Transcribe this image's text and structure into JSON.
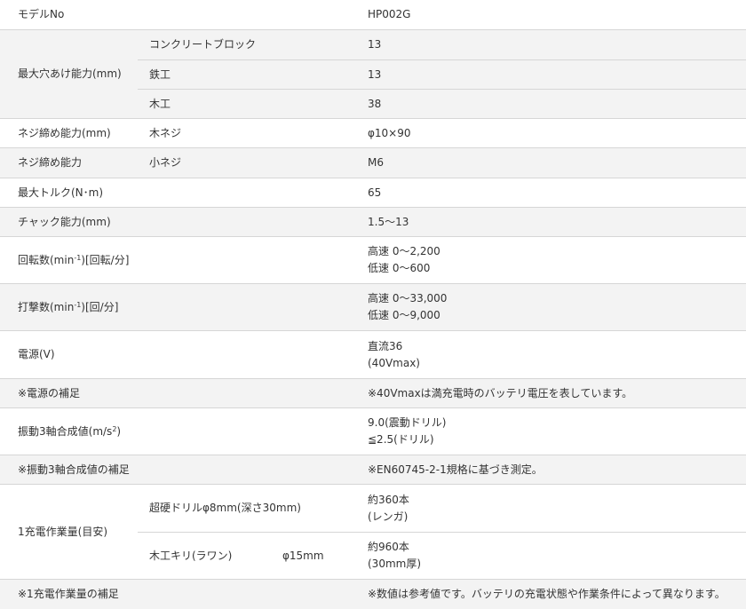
{
  "rows": {
    "model": {
      "label": "モデルNo",
      "value": "HP002G"
    },
    "drill": {
      "label": "最大穴あけ能力(mm)",
      "items": [
        {
          "sub": "コンクリートブロック",
          "value": "13"
        },
        {
          "sub": "鉄工",
          "value": "13"
        },
        {
          "sub": "木工",
          "value": "38"
        }
      ]
    },
    "screw_wood": {
      "label": "ネジ締め能力(mm)",
      "sub": "木ネジ",
      "value": "φ10×90"
    },
    "screw_small": {
      "label": "ネジ締め能力",
      "sub": "小ネジ",
      "value": "M6"
    },
    "torque": {
      "label": "最大トルク(N･m)",
      "value": "65"
    },
    "chuck": {
      "label": "チャック能力(mm)",
      "value": "1.5〜13"
    },
    "rpm": {
      "label_pre": "回転数(min",
      "label_sup": "-1",
      "label_post": ")[回転/分]",
      "line1": "高速 0〜2,200",
      "line2": "低速 0〜600"
    },
    "ipm": {
      "label_pre": "打撃数(min",
      "label_sup": "-1",
      "label_post": ")[回/分]",
      "line1": "高速 0〜33,000",
      "line2": "低速 0〜9,000"
    },
    "power": {
      "label": "電源(V)",
      "line1": "直流36",
      "line2": "(40Vmax)"
    },
    "power_note": {
      "label": "※電源の補足",
      "value": "※40Vmaxは満充電時のバッテリ電圧を表しています。"
    },
    "vibration": {
      "label_pre": "振動3軸合成値(m/s",
      "label_sup": "2",
      "label_post": ")",
      "line1": "9.0(震動ドリル)",
      "line2": "≦2.5(ドリル)"
    },
    "vibration_note": {
      "label": "※振動3軸合成値の補足",
      "value": "※EN60745-2-1規格に基づき測定。"
    },
    "workload": {
      "label": "1充電作業量(目安)",
      "items": [
        {
          "sub": "超硬ドリルφ8mm(深さ30mm)",
          "sub2": "",
          "line1": "約360本",
          "line2": "(レンガ)"
        },
        {
          "sub": "木工キリ(ラワン)",
          "sub2": "φ15mm",
          "line1": "約960本",
          "line2": "(30mm厚)"
        }
      ]
    },
    "workload_note": {
      "label": "※1充電作業量の補足",
      "value": "※数値は参考値です。バッテリの充電状態や作業条件によって異なります。"
    }
  }
}
